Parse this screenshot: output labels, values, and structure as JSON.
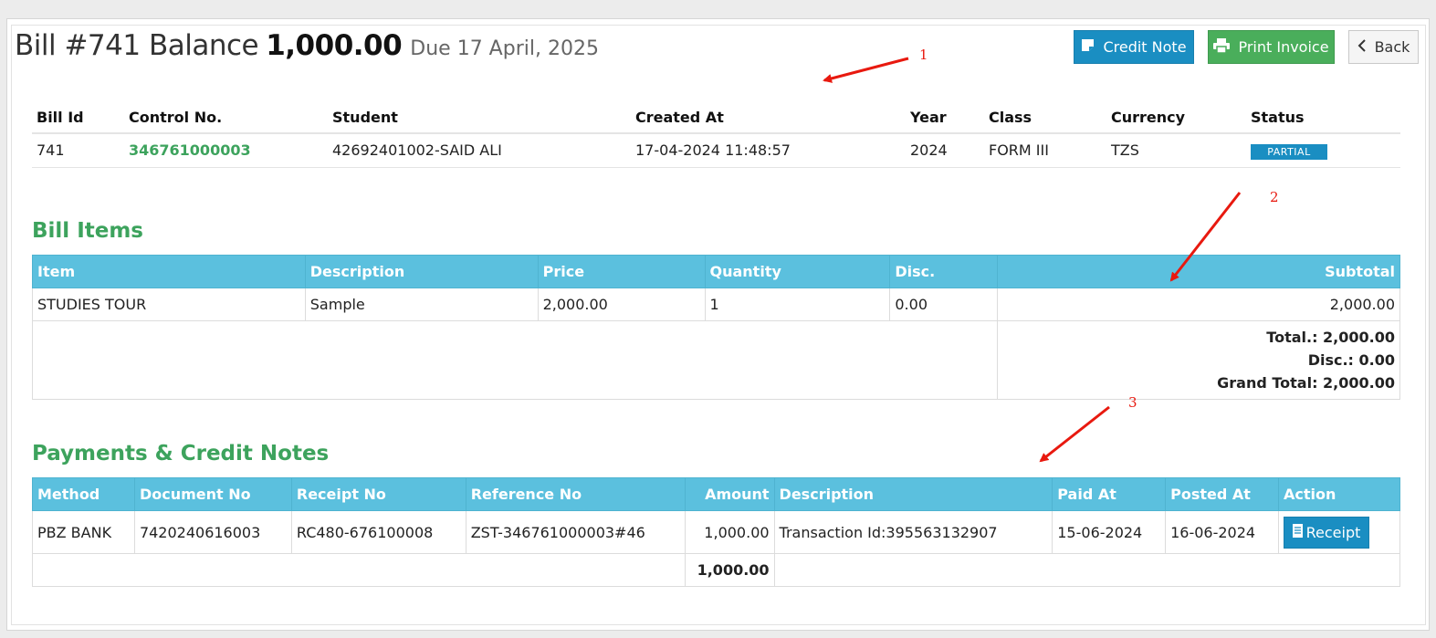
{
  "header": {
    "bill_label": "Bill #741 Balance",
    "balance": "1,000.00",
    "due": "Due 17 April, 2025"
  },
  "buttons": {
    "credit_note": "Credit Note",
    "print_invoice": "Print Invoice",
    "back": "Back"
  },
  "bill": {
    "headers": [
      "Bill Id",
      "Control No.",
      "Student",
      "Created At",
      "Year",
      "Class",
      "Currency",
      "Status"
    ],
    "row": {
      "bill_id": "741",
      "control_no": "346761000003",
      "student": "42692401002-SAID ALI",
      "created_at": "17-04-2024 11:48:57",
      "year": "2024",
      "class": "FORM III",
      "currency": "TZS",
      "status": "PARTIAL"
    }
  },
  "bill_items": {
    "title": "Bill Items",
    "headers": [
      "Item",
      "Description",
      "Price",
      "Quantity",
      "Disc.",
      "Subtotal"
    ],
    "rows": [
      {
        "item": "STUDIES TOUR",
        "description": "Sample",
        "price": "2,000.00",
        "quantity": "1",
        "disc": "0.00",
        "subtotal": "2,000.00"
      }
    ],
    "total": "Total.: 2,000.00",
    "disc": "Disc.: 0.00",
    "grand_total": "Grand Total: 2,000.00"
  },
  "payments": {
    "title": "Payments & Credit Notes",
    "headers": [
      "Method",
      "Document No",
      "Receipt No",
      "Reference No",
      "Amount",
      "Description",
      "Paid At",
      "Posted At",
      "Action"
    ],
    "rows": [
      {
        "method": "PBZ BANK",
        "document_no": "7420240616003",
        "receipt_no": "RC480-676100008",
        "reference_no": "ZST-346761000003#46",
        "amount": "1,000.00",
        "description": "Transaction Id:395563132907",
        "paid_at": "15-06-2024",
        "posted_at": "16-06-2024",
        "action": "Receipt"
      }
    ],
    "total_amount": "1,000.00"
  },
  "annotations": [
    "1",
    "2",
    "3"
  ],
  "colors": {
    "accent_green": "#3da35d",
    "header_blue": "#5bc0de",
    "button_blue": "#1a8ec2",
    "button_green": "#4aae5b",
    "annotation_red": "#e8190f"
  }
}
